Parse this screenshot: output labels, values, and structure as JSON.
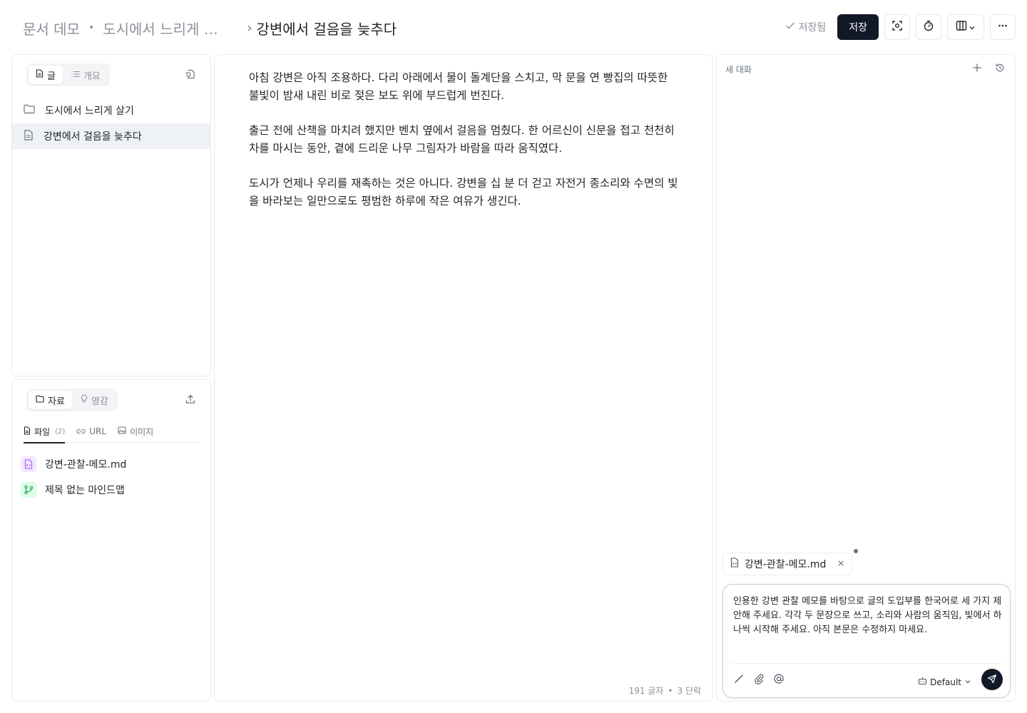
{
  "breadcrumb": {
    "root": "문서 데모",
    "separator": "•",
    "folder": "도시에서 느리게 …",
    "chevron": "›",
    "current": "강변에서 걸음을 늦추다"
  },
  "toolbar": {
    "saved_status": "저장됨",
    "save_label": "저장",
    "icons": [
      "check-icon",
      "focus-icon",
      "timer-icon",
      "columns-icon",
      "chevron-down-icon",
      "more-icon"
    ]
  },
  "doc_panel": {
    "tabs": [
      {
        "label": "글",
        "icon": "document-icon",
        "active": true
      },
      {
        "label": "개요",
        "icon": "list-icon",
        "active": false
      }
    ],
    "tree": [
      {
        "label": "도시에서 느리게 살기",
        "icon": "folder-icon",
        "selected": false
      },
      {
        "label": "강변에서 걸음을 늦추다",
        "icon": "document-icon",
        "selected": true
      }
    ]
  },
  "resources_panel": {
    "tabs": [
      {
        "label": "자료",
        "icon": "folder-icon",
        "active": true
      },
      {
        "label": "영감",
        "icon": "lightbulb-icon",
        "active": false
      }
    ],
    "subtabs": [
      {
        "label": "파일",
        "count": "(2)",
        "icon": "file-icon",
        "active": true
      },
      {
        "label": "URL",
        "icon": "link-icon",
        "active": false
      },
      {
        "label": "이미지",
        "icon": "image-icon",
        "active": false
      }
    ],
    "files": [
      {
        "label": "강변-관찰-메모.md",
        "icon": "markdown-file-icon",
        "color": "#a855f7"
      },
      {
        "label": "제목 없는 마인드맵",
        "icon": "mindmap-icon",
        "color": "#22c55e"
      }
    ]
  },
  "editor": {
    "paragraphs": [
      "아침 강변은 아직 조용하다. 다리 아래에서 물이 돌계단을 스치고, 막 문을 연 빵집의 따뜻한 불빛이 밤새 내린 비로 젖은 보도 위에 부드럽게 번진다.",
      "출근 전에 산책을 마치려 했지만 벤치 옆에서 걸음을 멈췄다. 한 어르신이 신문을 접고 천천히 차를 마시는 동안, 곁에 드리운 나무 그림자가 바람을 따라 움직였다.",
      "도시가 언제나 우리를 재촉하는 것은 아니다. 강변을 십 분 더 걷고 자전거 종소리와 수면의 빛을 바라보는 일만으로도 평범한 하루에 작은 여유가 생긴다."
    ],
    "char_count": "191 글자",
    "separator": "•",
    "paragraph_count": "3 단락"
  },
  "chat": {
    "title": "새 대화",
    "attachment": "강변-관찰-메모.md",
    "prompt": "인용한 강변 관찰 메모를 바탕으로 글의 도입부를 한국어로 세 가지 제안해 주세요. 각각 두 문장으로 쓰고, 소리와 사람의 움직임, 빛에서 하나씩 시작해 주세요. 아직 본문은 수정하지 마세요.",
    "model": "Default"
  },
  "colors": {
    "primary_button": "#111827",
    "selected_row": "#eef1f5",
    "muted_text": "#8b9099"
  }
}
